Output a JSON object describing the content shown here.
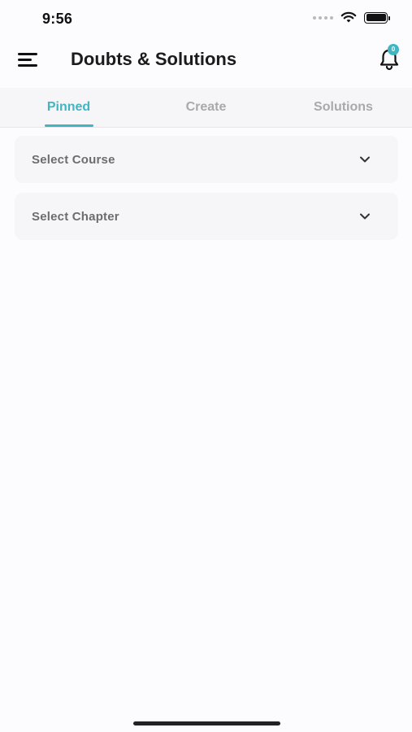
{
  "status_bar": {
    "time": "9:56",
    "icons": [
      "signal-dots-icon",
      "wifi-icon",
      "battery-icon"
    ]
  },
  "header": {
    "title": "Doubts & Solutions",
    "menu_icon": "hamburger-menu-icon",
    "notification_icon": "bell-icon",
    "notification_count": "0"
  },
  "tabs": [
    {
      "label": "Pinned",
      "active": true
    },
    {
      "label": "Create",
      "active": false
    },
    {
      "label": "Solutions",
      "active": false
    }
  ],
  "filters": {
    "course": {
      "value": "Select Course",
      "icon": "chevron-down-icon"
    },
    "chapter": {
      "value": "Select Chapter",
      "icon": "chevron-down-icon"
    }
  },
  "colors": {
    "accent": "#3fb6c2",
    "background": "#fcfbfd",
    "surface": "#f6f5f7",
    "inactive_tab": "#a9a9ad",
    "title": "#1b1b1b"
  }
}
